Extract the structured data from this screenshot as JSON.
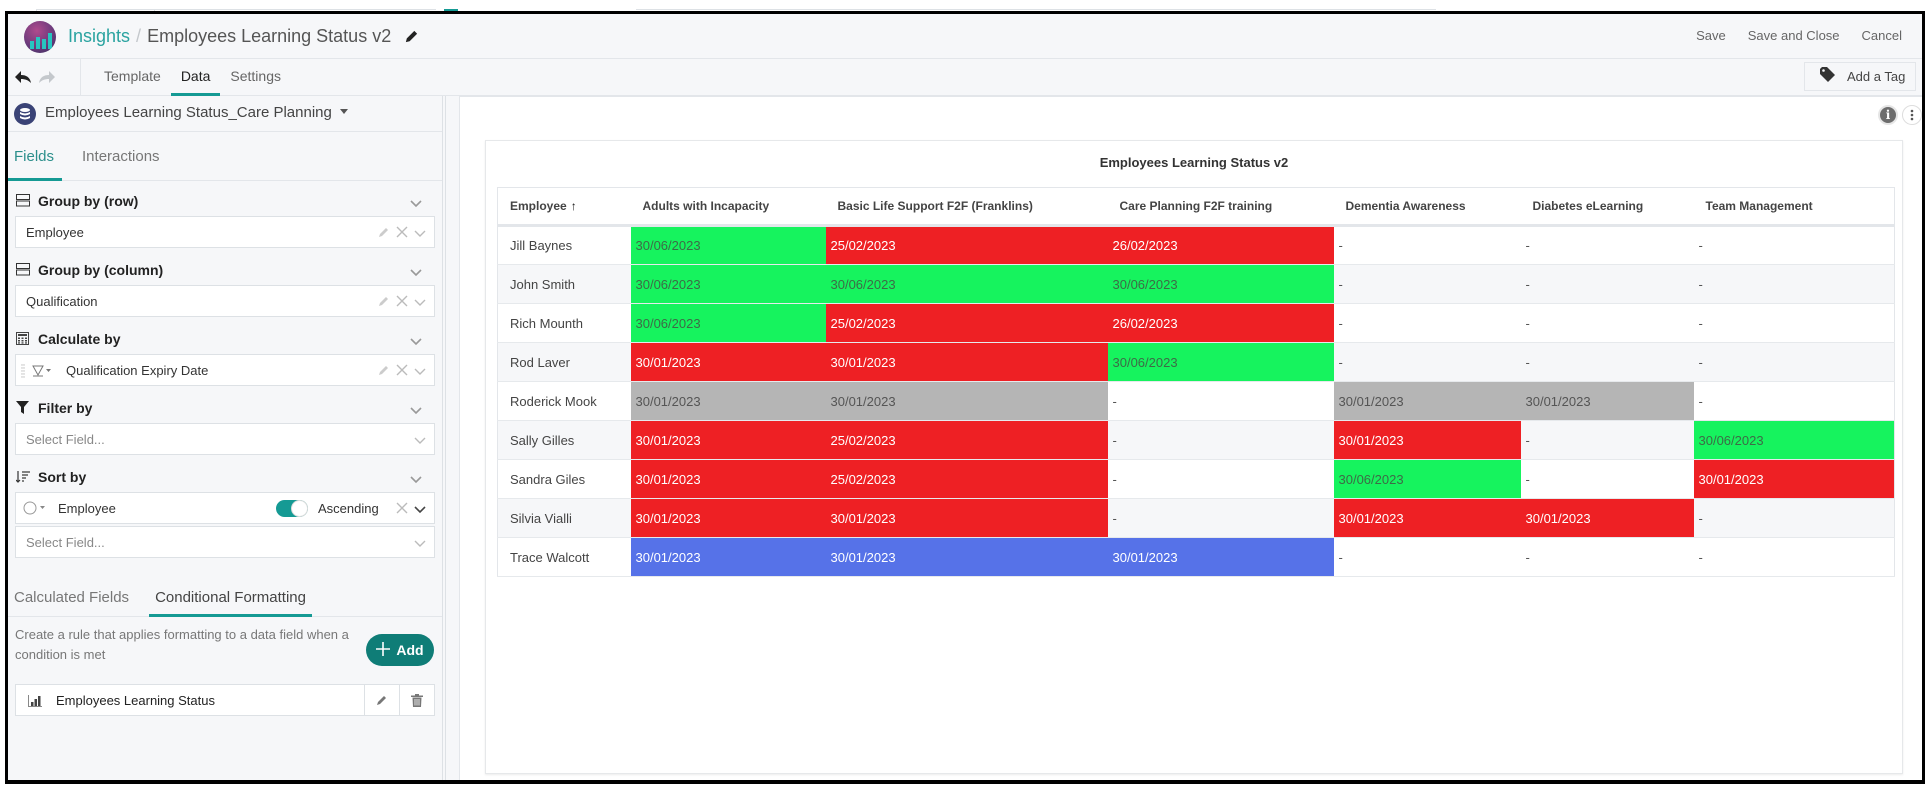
{
  "header": {
    "app_name": "Insights",
    "separator": "/",
    "report_title": "Employees Learning Status v2",
    "actions": [
      "Save",
      "Save and Close",
      "Cancel"
    ]
  },
  "toolbar": {
    "tabs": [
      "Template",
      "Data",
      "Settings"
    ],
    "active_tab": "Data",
    "add_tag_label": "Add a Tag"
  },
  "sidebar": {
    "datasource": "Employees Learning Status_Care Planning",
    "tabs": [
      "Fields",
      "Interactions"
    ],
    "active_tab": "Fields",
    "sections": {
      "group_row": {
        "title": "Group by (row)",
        "value": "Employee"
      },
      "group_col": {
        "title": "Group by (column)",
        "value": "Qualification"
      },
      "calculate": {
        "title": "Calculate by",
        "value": "Qualification Expiry Date"
      },
      "filter": {
        "title": "Filter by",
        "placeholder": "Select Field..."
      },
      "sort": {
        "title": "Sort by",
        "value": "Employee",
        "direction": "Ascending",
        "placeholder": "Select Field..."
      }
    },
    "bottom_tabs": [
      "Calculated Fields",
      "Conditional Formatting"
    ],
    "active_bottom_tab": "Conditional Formatting",
    "cf_description": "Create a rule that applies formatting to a data field when a condition is met",
    "add_label": "Add",
    "rules": [
      "Employees Learning Status"
    ]
  },
  "report": {
    "title": "Employees Learning Status v2",
    "columns": [
      "Employee",
      "Adults with Incapacity",
      "Basic Life Support F2F (Franklins)",
      "Care Planning F2F training",
      "Dementia Awareness",
      "Diabetes eLearning",
      "Team Management"
    ],
    "sort_indicator": "↑",
    "colors": {
      "green": "#16f35e",
      "red": "#ee2024",
      "grey": "#b5b5b5",
      "blue": "#5672e8"
    },
    "rows": [
      {
        "employee": "Jill Baynes",
        "cells": [
          {
            "v": "30/06/2023",
            "c": "green"
          },
          {
            "v": "25/02/2023",
            "c": "red"
          },
          {
            "v": "26/02/2023",
            "c": "red"
          },
          {
            "v": "-",
            "c": ""
          },
          {
            "v": "-",
            "c": ""
          },
          {
            "v": "-",
            "c": ""
          }
        ]
      },
      {
        "employee": "John Smith",
        "cells": [
          {
            "v": "30/06/2023",
            "c": "green"
          },
          {
            "v": "30/06/2023",
            "c": "green"
          },
          {
            "v": "30/06/2023",
            "c": "green"
          },
          {
            "v": "-",
            "c": ""
          },
          {
            "v": "-",
            "c": ""
          },
          {
            "v": "-",
            "c": ""
          }
        ]
      },
      {
        "employee": "Rich Mounth",
        "cells": [
          {
            "v": "30/06/2023",
            "c": "green"
          },
          {
            "v": "25/02/2023",
            "c": "red"
          },
          {
            "v": "26/02/2023",
            "c": "red"
          },
          {
            "v": "-",
            "c": ""
          },
          {
            "v": "-",
            "c": ""
          },
          {
            "v": "-",
            "c": ""
          }
        ]
      },
      {
        "employee": "Rod Laver",
        "cells": [
          {
            "v": "30/01/2023",
            "c": "red"
          },
          {
            "v": "30/01/2023",
            "c": "red"
          },
          {
            "v": "30/06/2023",
            "c": "green"
          },
          {
            "v": "-",
            "c": ""
          },
          {
            "v": "-",
            "c": ""
          },
          {
            "v": "-",
            "c": ""
          }
        ]
      },
      {
        "employee": "Roderick Mook",
        "cells": [
          {
            "v": "30/01/2023",
            "c": "grey"
          },
          {
            "v": "30/01/2023",
            "c": "grey"
          },
          {
            "v": "-",
            "c": ""
          },
          {
            "v": "30/01/2023",
            "c": "grey"
          },
          {
            "v": "30/01/2023",
            "c": "grey"
          },
          {
            "v": "-",
            "c": ""
          }
        ]
      },
      {
        "employee": "Sally Gilles",
        "cells": [
          {
            "v": "30/01/2023",
            "c": "red"
          },
          {
            "v": "25/02/2023",
            "c": "red"
          },
          {
            "v": "-",
            "c": ""
          },
          {
            "v": "30/01/2023",
            "c": "red"
          },
          {
            "v": "-",
            "c": ""
          },
          {
            "v": "30/06/2023",
            "c": "green"
          }
        ]
      },
      {
        "employee": "Sandra Giles",
        "cells": [
          {
            "v": "30/01/2023",
            "c": "red"
          },
          {
            "v": "25/02/2023",
            "c": "red"
          },
          {
            "v": "-",
            "c": ""
          },
          {
            "v": "30/06/2023",
            "c": "green"
          },
          {
            "v": "-",
            "c": ""
          },
          {
            "v": "30/01/2023",
            "c": "red"
          }
        ]
      },
      {
        "employee": "Silvia Vialli",
        "cells": [
          {
            "v": "30/01/2023",
            "c": "red"
          },
          {
            "v": "30/01/2023",
            "c": "red"
          },
          {
            "v": "-",
            "c": ""
          },
          {
            "v": "30/01/2023",
            "c": "red"
          },
          {
            "v": "30/01/2023",
            "c": "red"
          },
          {
            "v": "-",
            "c": ""
          }
        ]
      },
      {
        "employee": "Trace Walcott",
        "cells": [
          {
            "v": "30/01/2023",
            "c": "blue"
          },
          {
            "v": "30/01/2023",
            "c": "blue"
          },
          {
            "v": "30/01/2023",
            "c": "blue"
          },
          {
            "v": "-",
            "c": ""
          },
          {
            "v": "-",
            "c": ""
          },
          {
            "v": "-",
            "c": ""
          }
        ]
      }
    ]
  }
}
